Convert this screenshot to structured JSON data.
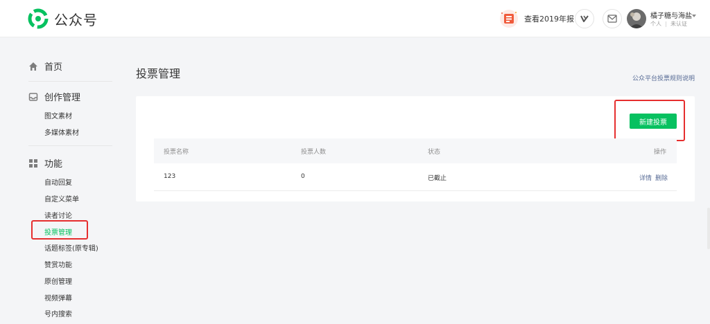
{
  "header": {
    "logo_text": "公众号",
    "annual_report": "查看2019年报",
    "user": {
      "name": "橘子糖与海盐",
      "type": "个人",
      "verification": "未认证"
    },
    "icons": {
      "logo": "wechat-official-logo",
      "annual": "annual-report-icon",
      "v": "verified-v-icon",
      "mail": "mail-icon",
      "caret": "caret-down-icon"
    }
  },
  "sidebar": {
    "home": "首页",
    "creation": {
      "title": "创作管理",
      "items": [
        "图文素材",
        "多媒体素材"
      ]
    },
    "functions": {
      "title": "功能",
      "items": [
        "自动回复",
        "自定义菜单",
        "读者讨论",
        "投票管理",
        "话题标签(原专辑)",
        "赞赏功能",
        "原创管理",
        "视频弹幕",
        "号内搜索"
      ],
      "active_index": 3
    }
  },
  "main": {
    "title": "投票管理",
    "rules_link": "公众平台投票规则说明",
    "new_button": "新建投票",
    "table": {
      "headers": [
        "投票名称",
        "投票人数",
        "状态",
        "操作"
      ],
      "rows": [
        {
          "name": "123",
          "count": "0",
          "status": "已截止",
          "actions": [
            "详情",
            "删除"
          ]
        }
      ]
    }
  },
  "colors": {
    "brand_green": "#07c160",
    "link_blue": "#576b95",
    "highlight_red": "#e62e2e"
  }
}
